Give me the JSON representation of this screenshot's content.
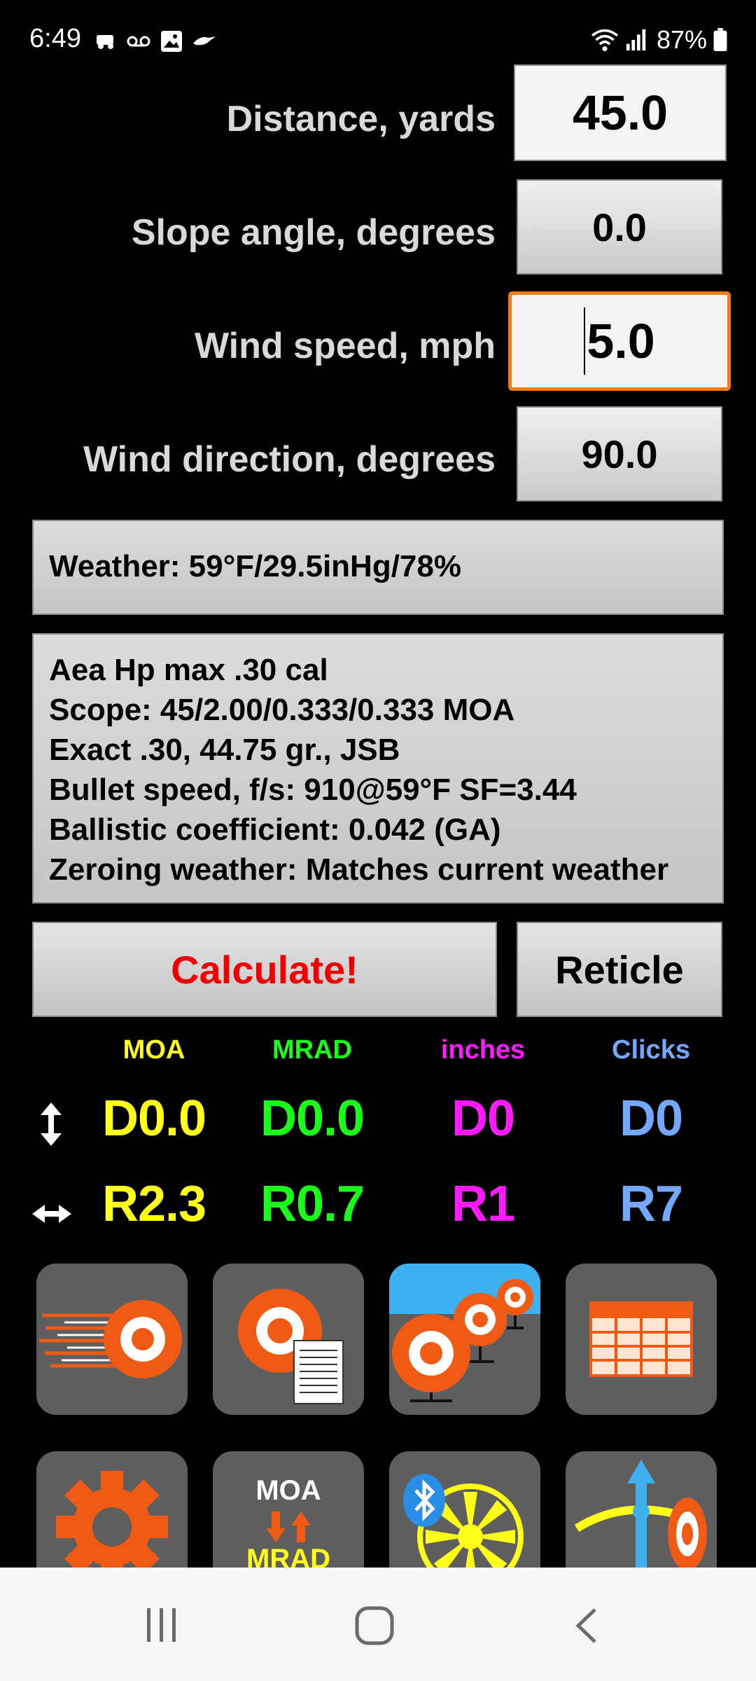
{
  "status": {
    "time": "6:49",
    "battery": "87%"
  },
  "inputs": {
    "distance": {
      "label": "Distance, yards",
      "value": "45.0"
    },
    "slope": {
      "label": "Slope angle, degrees",
      "value": "0.0"
    },
    "wind_speed": {
      "label": "Wind speed, mph",
      "value": "5.0"
    },
    "wind_direction": {
      "label": "Wind direction, degrees",
      "value": "90.0"
    }
  },
  "weather": {
    "text": "Weather: 59°F/29.5inHg/78%"
  },
  "profile": {
    "lines": [
      "Aea Hp max .30 cal",
      "Scope: 45/2.00/0.333/0.333 MOA",
      "Exact .30, 44.75 gr., JSB",
      "Bullet speed, f/s: 910@59°F SF=3.44",
      "Ballistic coefficient: 0.042 (GA)",
      "Zeroing weather: Matches current weather"
    ]
  },
  "actions": {
    "calculate": "Calculate!",
    "reticle": "Reticle"
  },
  "results": {
    "headers": [
      "MOA",
      "MRAD",
      "inches",
      "Clicks"
    ],
    "vertical": [
      "D0.0",
      "D0.0",
      "D0",
      "D0"
    ],
    "horizontal": [
      "R2.3",
      "R0.7",
      "R1",
      "R7"
    ]
  },
  "tiles": {
    "conversion_top": "MOA",
    "conversion_bottom": "MRAD"
  },
  "colors": {
    "moa": "#ffff1a",
    "mrad": "#1aff1a",
    "inches": "#ff1aff",
    "clicks": "#74a8ff",
    "calculate": "#ee0000",
    "accent": "#f07c14",
    "target_orange": "#f05a14"
  }
}
